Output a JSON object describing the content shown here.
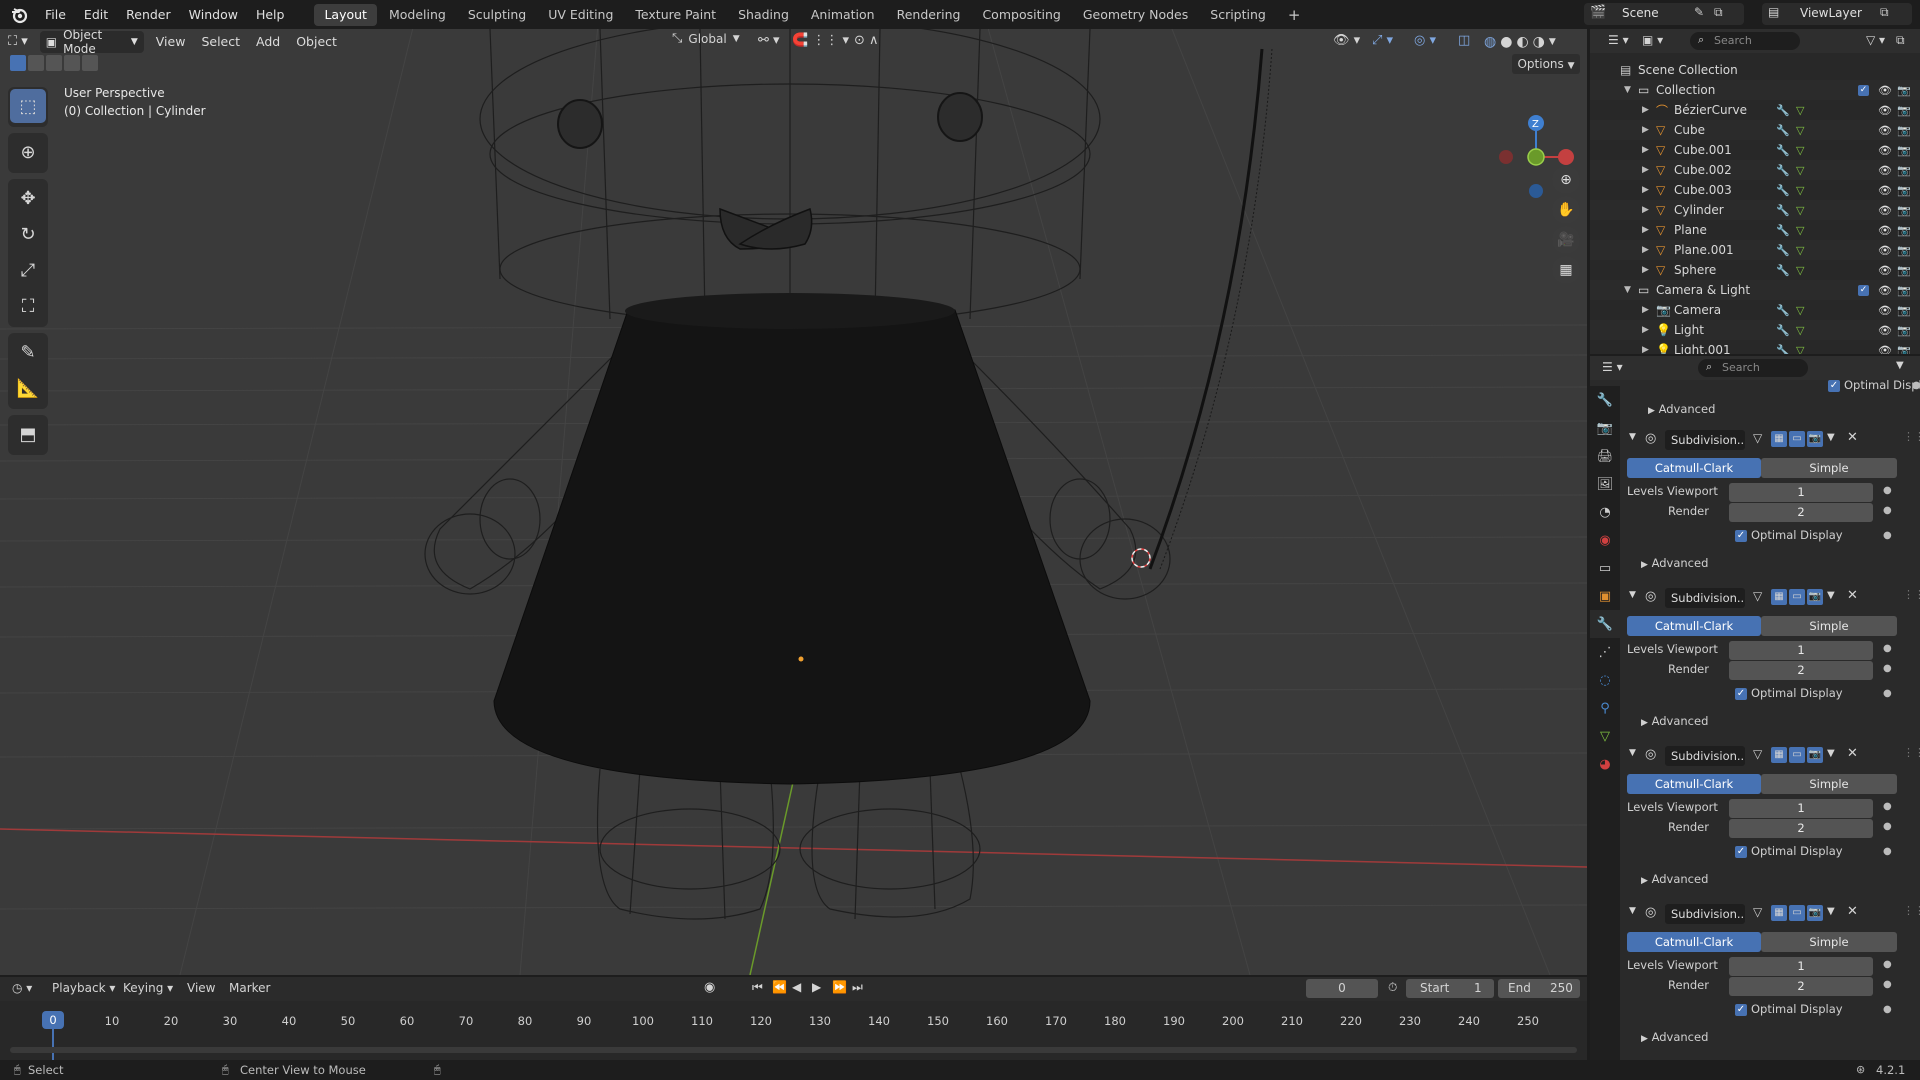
{
  "menu": [
    "File",
    "Edit",
    "Render",
    "Window",
    "Help"
  ],
  "workspaces": [
    "Layout",
    "Modeling",
    "Sculpting",
    "UV Editing",
    "Texture Paint",
    "Shading",
    "Animation",
    "Rendering",
    "Compositing",
    "Geometry Nodes",
    "Scripting"
  ],
  "active_workspace": "Layout",
  "scene": {
    "name": "Scene",
    "view_layer": "ViewLayer"
  },
  "viewport": {
    "mode": "Object Mode",
    "menus": [
      "View",
      "Select",
      "Add",
      "Object"
    ],
    "transform": "Global",
    "options": "Options",
    "overlay_line1": "User Perspective",
    "overlay_line2": "(0) Collection | Cylinder",
    "gizmo": {
      "z": "Z"
    }
  },
  "outliner": {
    "search_placeholder": "Search",
    "root": "Scene Collection",
    "collection": "Collection",
    "items": [
      "BézierCurve",
      "Cube",
      "Cube.001",
      "Cube.002",
      "Cube.003",
      "Cylinder",
      "Plane",
      "Plane.001",
      "Sphere"
    ],
    "collection2": "Camera & Light",
    "items2": [
      "Camera",
      "Light",
      "Light.001"
    ]
  },
  "properties": {
    "search_placeholder": "Search",
    "optimal_display": "Optimal Display",
    "advanced": "Advanced",
    "modifiers": [
      {
        "name": "Subdivision...",
        "method_on": "Catmull-Clark",
        "method_off": "Simple",
        "levels_label": "Levels Viewport",
        "levels": "1",
        "render_label": "Render",
        "render": "2",
        "optimal": "Optimal Display",
        "advanced": "Advanced"
      },
      {
        "name": "Subdivision...",
        "method_on": "Catmull-Clark",
        "method_off": "Simple",
        "levels_label": "Levels Viewport",
        "levels": "1",
        "render_label": "Render",
        "render": "2",
        "optimal": "Optimal Display",
        "advanced": "Advanced"
      },
      {
        "name": "Subdivision...",
        "method_on": "Catmull-Clark",
        "method_off": "Simple",
        "levels_label": "Levels Viewport",
        "levels": "1",
        "render_label": "Render",
        "render": "2",
        "optimal": "Optimal Display",
        "advanced": "Advanced"
      },
      {
        "name": "Subdivision...",
        "method_on": "Catmull-Clark",
        "method_off": "Simple",
        "levels_label": "Levels Viewport",
        "levels": "1",
        "render_label": "Render",
        "render": "2",
        "optimal": "Optimal Display",
        "advanced": "Advanced"
      }
    ]
  },
  "timeline": {
    "menus": [
      "Playback",
      "Keying",
      "View",
      "Marker"
    ],
    "current_frame": "0",
    "start_label": "Start",
    "start": "1",
    "end_label": "End",
    "end": "250",
    "ticks": [
      "0",
      "10",
      "20",
      "30",
      "40",
      "50",
      "60",
      "70",
      "80",
      "90",
      "100",
      "110",
      "120",
      "130",
      "140",
      "150",
      "160",
      "170",
      "180",
      "190",
      "200",
      "210",
      "220",
      "230",
      "240",
      "250"
    ],
    "playhead": "0"
  },
  "status": {
    "select": "Select",
    "center": "Center View to Mouse",
    "version": "4.2.1"
  },
  "colors": {
    "accent": "#4772b3",
    "viewport_bg": "#3a3a3a",
    "panel": "#2a2a2a",
    "x_axis": "#c44040",
    "y_axis": "#6a9a2a",
    "z_axis": "#3f7fd0"
  }
}
